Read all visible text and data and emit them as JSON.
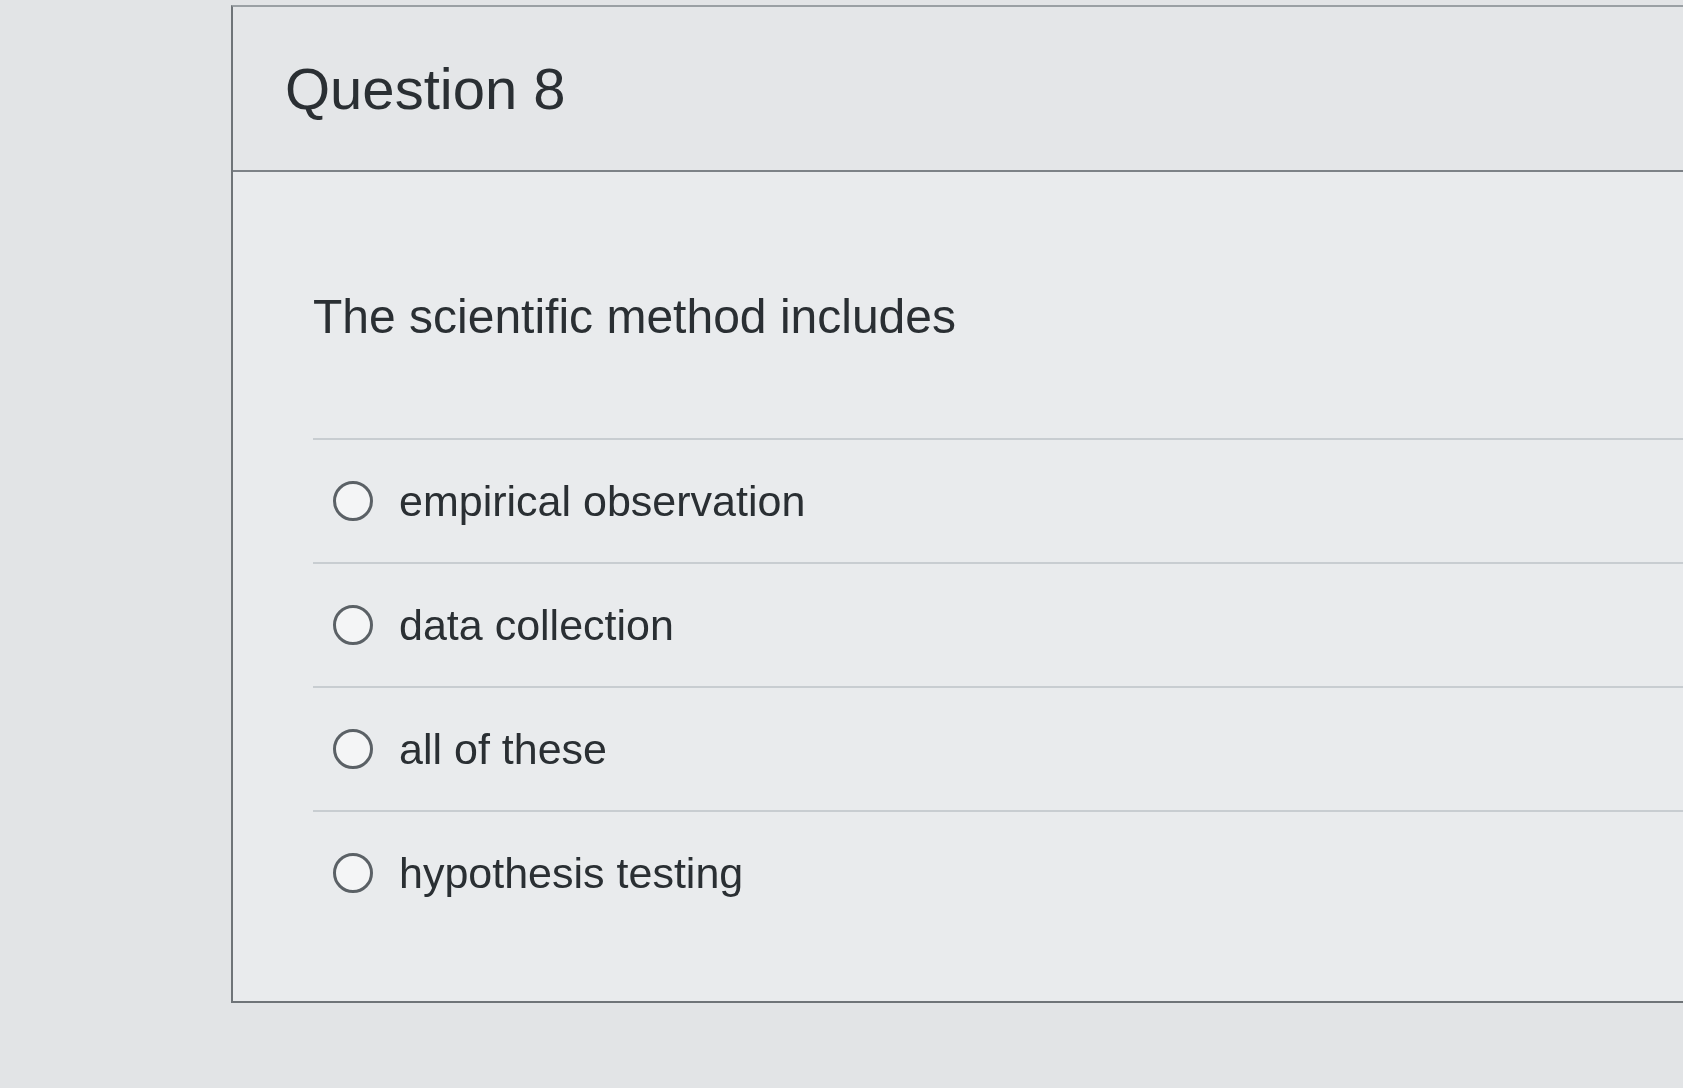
{
  "question": {
    "title": "Question 8",
    "prompt": "The scientific method includes",
    "options": [
      {
        "label": "empirical observation",
        "selected": false
      },
      {
        "label": "data collection",
        "selected": false
      },
      {
        "label": "all of these",
        "selected": false
      },
      {
        "label": "hypothesis testing",
        "selected": false
      }
    ]
  }
}
